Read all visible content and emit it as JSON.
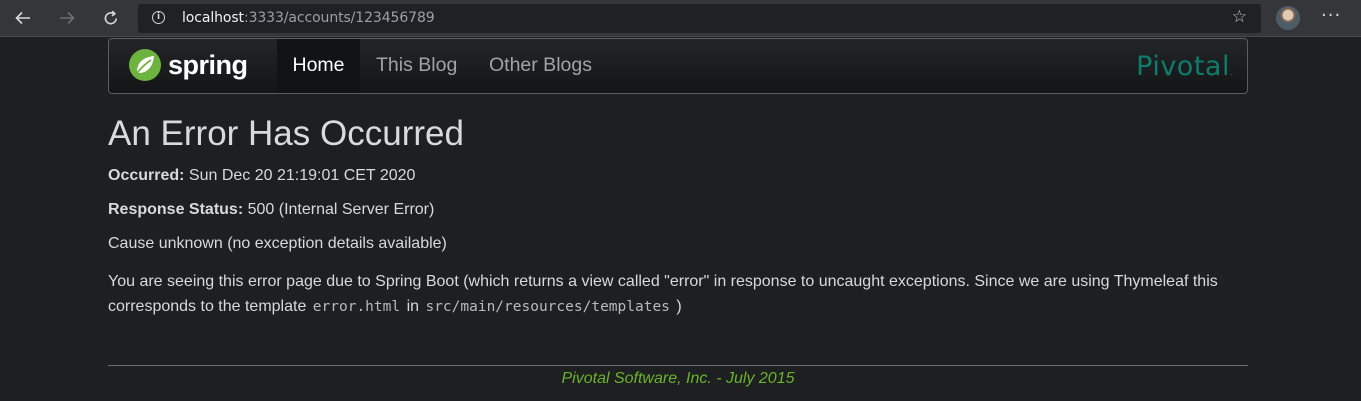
{
  "browser": {
    "url_host": "localhost",
    "url_rest": ":3333/accounts/123456789",
    "icons": {
      "back": "back-arrow-icon",
      "forward": "forward-arrow-icon",
      "reload": "reload-icon",
      "info": "info-icon",
      "star": "star-icon",
      "menu": "more-icon"
    },
    "info_glyph": "i",
    "star_glyph": "☆",
    "menu_glyph": "···"
  },
  "navbar": {
    "brand": "spring",
    "items": [
      {
        "label": "Home",
        "active": true
      },
      {
        "label": "This Blog",
        "active": false
      },
      {
        "label": "Other Blogs",
        "active": false
      }
    ],
    "partner_logo": "Pivotal",
    "partner_logo_dot": "."
  },
  "error": {
    "title": "An Error Has Occurred",
    "occurred_label": "Occurred:",
    "occurred_value": "Sun Dec 20 21:19:01 CET 2020",
    "status_label": "Response Status:",
    "status_value": "500 (Internal Server Error)",
    "cause": "Cause unknown (no exception details available)",
    "explanation_1": "You are seeing this error page due to Spring Boot (which returns a view called \"error\" in response to uncaught exceptions. Since we are using Thymeleaf this corresponds to the template",
    "template_file": "error.html",
    "explanation_in": "in",
    "template_dir": "src/main/resources/templates",
    "explanation_close": ")"
  },
  "footer": {
    "text": "Pivotal Software, Inc. - July 2015"
  },
  "colors": {
    "page_bg": "#1e1f20",
    "footer_text": "#6ab42d",
    "pivotal_teal": "#0e7c6c",
    "spring_green": "#6db33f"
  }
}
